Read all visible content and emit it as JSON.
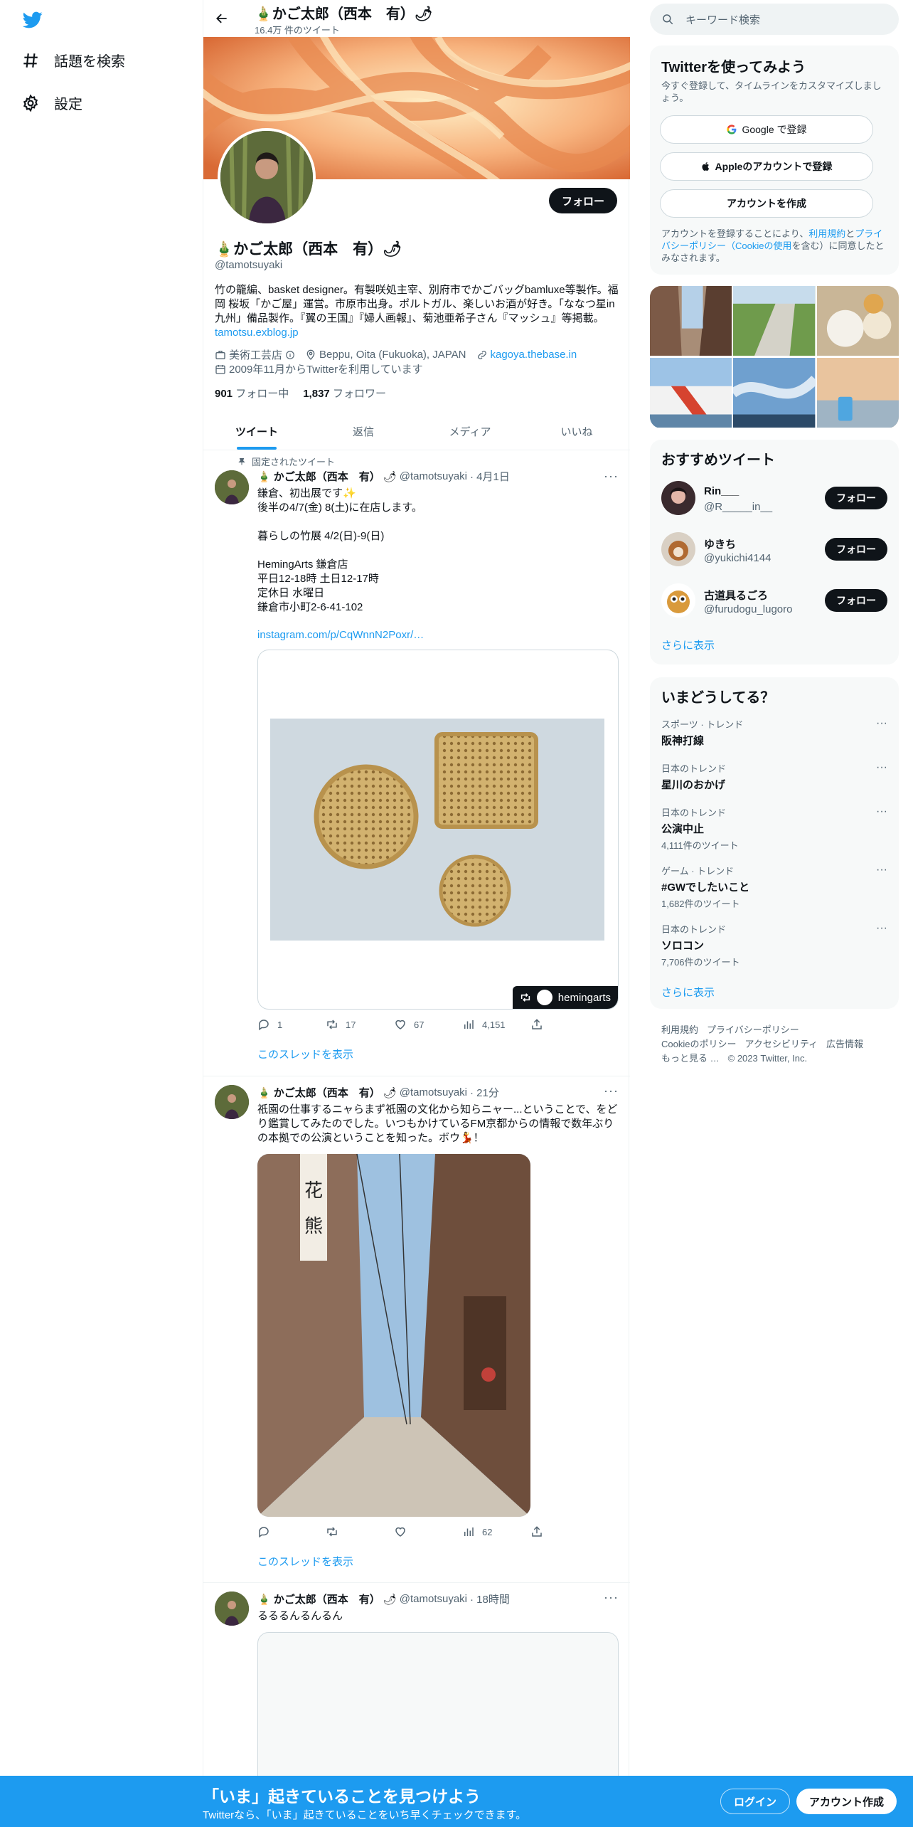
{
  "nav": {
    "explore_label": "話題を検索",
    "settings_label": "設定"
  },
  "profile": {
    "name": "かご太郎（西本　有）",
    "tweet_count": "16.4万 件のツイート",
    "handle": "@tamotsuyaki",
    "follow_label": "フォロー",
    "bio": "竹の籠編、basket designer。有製咲処主宰、別府市でかごバッグbamluxe等製作。福岡 桜坂「かご屋」運営。市原市出身。ポルトガル、楽しいお酒が好き。「ななつ星in九州」備品製作。『翼の王国』『婦人画報』、菊池亜希子さん『マッシュ』等掲載。",
    "bio_link": "tamotsu.exblog.jp",
    "category": "美術工芸店",
    "location": "Beppu, Oita (Fukuoka), JAPAN",
    "website": "kagoya.thebase.in",
    "joined": "2009年11月からTwitterを利用しています",
    "following_count": "901",
    "following_label": "フォロー中",
    "followers_count": "1,837",
    "followers_label": "フォロワー"
  },
  "tabs": [
    "ツイート",
    "返信",
    "メディア",
    "いいね"
  ],
  "tweets": [
    {
      "pinned_label": "固定されたツイート",
      "name": "かご太郎（西本　有）",
      "handle": "@tamotsuyaki",
      "time": "· 4月1日",
      "text": "鎌倉、初出展です✨\n後半の4/7(金) 8(土)に在店します。\n\n暮らしの竹展 4/2(日)-9(日)\n\nHemingArts 鎌倉店\n平日12-18時 土日12-17時\n定休日 水曜日\n鎌倉市小町2-6-41-102",
      "link": "instagram.com/p/CqWnnN2Poxr/…",
      "card_label": "hemingarts",
      "replies": "1",
      "retweets": "17",
      "likes": "67",
      "views": "4,151",
      "show_thread": "このスレッドを表示"
    },
    {
      "name": "かご太郎（西本　有）",
      "handle": "@tamotsuyaki",
      "time": "· 21分",
      "text": "祇園の仕事するニャらまず祇園の文化から知らニャー...ということで、をどり鑑賞してみたのでした。いつもかけているFM京都からの情報で数年ぶりの本拠での公演ということを知った。ボウ💃！",
      "views": "62",
      "show_thread": "このスレッドを表示"
    },
    {
      "name": "かご太郎（西本　有）",
      "handle": "@tamotsuyaki",
      "time": "· 18時間",
      "text": "るるるんるんるん"
    }
  ],
  "right": {
    "search_placeholder": "キーワード検索",
    "signup": {
      "title": "Twitterを使ってみよう",
      "sub": "今すぐ登録して、タイムラインをカスタマイズしましょう。",
      "google": "Google で登録",
      "apple": "Appleのアカウントで登録",
      "create": "アカウントを作成",
      "terms_1": "アカウントを登録することにより、",
      "terms_link1": "利用規約",
      "terms_2": "と",
      "terms_link2": "プライバシーポリシー（Cookieの使用",
      "terms_3": "を含む）に同意したとみなされます。"
    },
    "recommended": {
      "title": "おすすめツイート",
      "users": [
        {
          "name": "Rin___",
          "handle": "@R_____in__",
          "follow": "フォロー"
        },
        {
          "name": "ゆきち",
          "handle": "@yukichi4144",
          "follow": "フォロー"
        },
        {
          "name": "古道具るごろ",
          "handle": "@furudogu_lugoro",
          "follow": "フォロー"
        }
      ],
      "more": "さらに表示"
    },
    "trends": {
      "title": "いまどうしてる？",
      "items": [
        {
          "context": "スポーツ · トレンド",
          "topic": "阪神打線",
          "count": ""
        },
        {
          "context": "日本のトレンド",
          "topic": "星川のおかげ",
          "count": ""
        },
        {
          "context": "日本のトレンド",
          "topic": "公演中止",
          "count": "4,111件のツイート"
        },
        {
          "context": "ゲーム · トレンド",
          "topic": "#GWでしたいこと",
          "count": "1,682件のツイート"
        },
        {
          "context": "日本のトレンド",
          "topic": "ソロコン",
          "count": "7,706件のツイート"
        }
      ],
      "more": "さらに表示"
    },
    "footer": {
      "terms": "利用規約",
      "privacy": "プライバシーポリシー",
      "cookie": "Cookieのポリシー",
      "access": "アクセシビリティ",
      "ads": "広告情報",
      "more": "もっと見る …",
      "copy": "© 2023 Twitter, Inc."
    }
  },
  "bottombar": {
    "title": "「いま」起きていることを見つけよう",
    "sub": "Twitterなら、「いま」起きていることをいち早くチェックできます。",
    "login": "ログイン",
    "signup": "アカウント作成"
  }
}
